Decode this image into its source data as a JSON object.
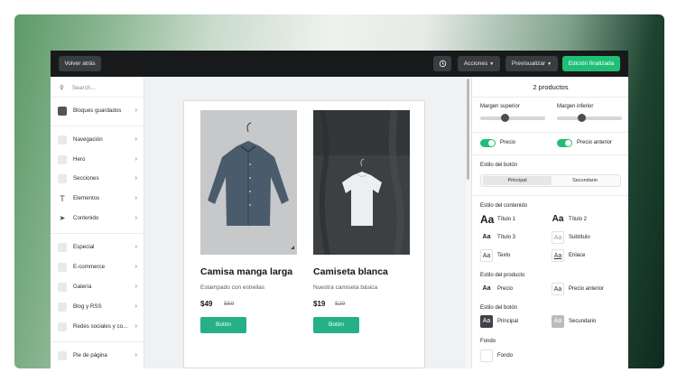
{
  "toolbar": {
    "back_label": "Volver atrás",
    "history_icon": "history-icon",
    "actions_label": "Acciones",
    "preview_label": "Previsualizar",
    "finish_label": "Edición finalizada"
  },
  "sidebar": {
    "search_placeholder": "Search...",
    "saved_blocks": "Bloques guardados",
    "items": [
      {
        "label": "Navegación",
        "icon": "navigation-icon"
      },
      {
        "label": "Hero",
        "icon": "hero-icon"
      },
      {
        "label": "Secciones",
        "icon": "sections-icon"
      },
      {
        "label": "Elementos",
        "icon": "text-element-icon"
      },
      {
        "label": "Contenido",
        "icon": "cursor-icon"
      },
      {
        "label": "Especial",
        "icon": "special-icon"
      },
      {
        "label": "E-commerce",
        "icon": "tag-icon"
      },
      {
        "label": "Galería",
        "icon": "image-icon"
      },
      {
        "label": "Blog y RSS",
        "icon": "rss-icon"
      },
      {
        "label": "Redes sociales y co...",
        "icon": "twitter-icon"
      },
      {
        "label": "Pie de página",
        "icon": "footer-icon"
      }
    ]
  },
  "products": [
    {
      "title": "Camisa manga larga",
      "subtitle": "Estampado con estrellas",
      "price": "$49",
      "old_price": "$69",
      "button": "Botón"
    },
    {
      "title": "Camiseta blanca",
      "subtitle": "Nuestra camiseta básica",
      "price": "$19",
      "old_price": "$29",
      "button": "Botón"
    }
  ],
  "panel": {
    "title": "2 productos",
    "margin_top": "Margen superior",
    "margin_bottom": "Margen inferior",
    "price_toggle": "Precio",
    "old_price_toggle": "Precio anterior",
    "button_style": "Estilo del botón",
    "seg_primary": "Principal",
    "seg_secondary": "Secundario",
    "content_style": "Estilo del contenido",
    "title1": "Título 1",
    "title2": "Título 2",
    "title3": "Título 3",
    "subtitle": "Subtítulo",
    "text": "Texto",
    "link": "Enlace",
    "product_style": "Estilo del producto",
    "price": "Precio",
    "old_price": "Precio anterior",
    "button_style2": "Estilo del botón",
    "btn_primary": "Principal",
    "btn_secondary": "Secundario",
    "background_heading": "Fondo",
    "background_label": "Fondo",
    "swatch_text": "Aa",
    "colors": {
      "accent": "#1fbf76",
      "button": "#26b088",
      "topbar": "#17191b"
    }
  }
}
